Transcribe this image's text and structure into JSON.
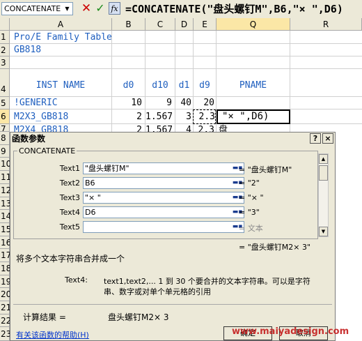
{
  "formula_bar": {
    "name_box": "CONCATENATE",
    "formula": "=CONCATENATE(\"盘头螺钉M\",B6,\"× \",D6)"
  },
  "columns": [
    "A",
    "B",
    "C",
    "D",
    "E",
    "Q",
    "R"
  ],
  "rows": [
    "1",
    "2",
    "3",
    "4",
    "5",
    "6",
    "7",
    "8",
    "9",
    "10",
    "11",
    "12",
    "13",
    "14",
    "15",
    "16",
    "17",
    "18",
    "19",
    "20",
    "21",
    "22",
    "23"
  ],
  "cells": {
    "a1": "Pro/E Family Table",
    "a2": "GB818",
    "a4": "INST NAME",
    "b4": "d0",
    "c4": "d10",
    "d4": "d1",
    "e4": "d9",
    "q4": "PNAME",
    "a5": "!GENERIC",
    "b5": "10",
    "c5": "9",
    "d5": "40",
    "e5": "20",
    "a6": "M2X3_GB818",
    "b6": "2",
    "c6": "1.567",
    "d6": "3",
    "e6": "2.3",
    "q6": "\"× \",D6)",
    "a7": "M2X4_GB818",
    "b7": "2",
    "c7": "1.567",
    "d7": "4",
    "e7": "2.3",
    "q7": "盘"
  },
  "dialog": {
    "title": "函数参数",
    "help_btn": "?",
    "close_btn": "×",
    "group_title": "CONCATENATE",
    "args": [
      {
        "label": "Text1",
        "value": "\"盘头螺钉M\"",
        "result": "= \"盘头螺钉M\""
      },
      {
        "label": "Text2",
        "value": "B6",
        "result": "= \"2\""
      },
      {
        "label": "Text3",
        "value": "\"× \"",
        "result": "= \"× \""
      },
      {
        "label": "Text4",
        "value": "D6",
        "result": "= \"3\""
      },
      {
        "label": "Text5",
        "value": "",
        "result": "= 文本"
      }
    ],
    "overall_result": "= \"盘头螺钉M2× 3\"",
    "description": "将多个文本字符串合并成一个",
    "arg_help_label": "Text4:",
    "arg_help_line1": "text1,text2,... 1 到 30 个要合并的文本字符串。可以是字符",
    "arg_help_line2": "串、数字或对单个单元格的引用",
    "calc_label": "计算结果 =",
    "calc_value": "盘头螺钉M2× 3",
    "help_link": "有关该函数的帮助(H)",
    "ok": "确定",
    "cancel": "取消"
  },
  "watermark": "www.maiyadesign.com",
  "icons": {
    "cancel": "cross-icon",
    "enter": "check-icon",
    "fx": "fx-icon",
    "collapse": "collapse-dialog-icon"
  }
}
